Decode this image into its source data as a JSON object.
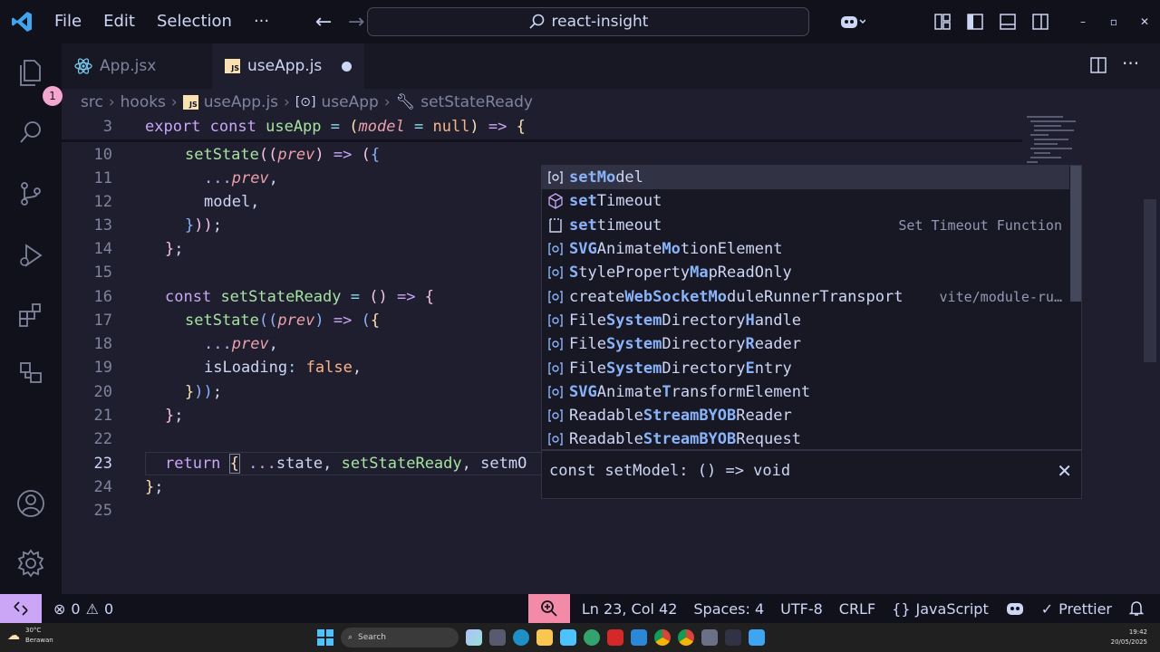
{
  "titlebar": {
    "menu": [
      "File",
      "Edit",
      "Selection",
      "···"
    ],
    "search_text": "react-insight",
    "window_controls": [
      "–",
      "▫",
      "✕"
    ]
  },
  "activity": {
    "explorer_badge": "1"
  },
  "tabs": [
    {
      "label": "App.jsx",
      "active": false
    },
    {
      "label": "useApp.js",
      "active": true,
      "dirty": true
    }
  ],
  "breadcrumb": [
    "src",
    "hooks",
    "useApp.js",
    "useApp",
    "setStateReady"
  ],
  "sticky_line": {
    "number": "3"
  },
  "line_numbers": [
    "10",
    "11",
    "12",
    "13",
    "14",
    "15",
    "16",
    "17",
    "18",
    "19",
    "20",
    "21",
    "22",
    "23",
    "24",
    "25"
  ],
  "code": {
    "export": "export",
    "const": "const",
    "useApp": "useApp",
    "eq": "=",
    "lp": "(",
    "model": "model",
    "null": "null",
    "rp": ")",
    "arrow": "=>",
    "lb": "{",
    "setState": "setState",
    "prev": "prev",
    "spread": "...",
    "model_prop": "model,",
    "close_obj": "}));",
    "close_fn": "};",
    "setStateReady": "setStateReady",
    "empty_parens": "()",
    "isLoading": "isLoading",
    "colon": ":",
    "false": "false",
    "comma": ",",
    "return": "return",
    "state": "state",
    "setmO": "setmO"
  },
  "suggestions": [
    {
      "pre": "",
      "match": "setMo",
      "post": "del",
      "icon": "variable-icon",
      "detail": "",
      "selected": true
    },
    {
      "pre": "",
      "match": "set",
      "post": "Timeout",
      "icon": "method-icon",
      "detail": "",
      "selected": false
    },
    {
      "pre": "",
      "match": "set",
      "post": "timeout",
      "icon": "snippet-icon",
      "detail": "Set Timeout Function",
      "selected": false
    },
    {
      "pre": "",
      "match": "SVG",
      "post": "Animate",
      "match2": "Mo",
      "post2": "tionElement",
      "icon": "variable-icon",
      "detail": "",
      "selected": false
    },
    {
      "pre": "",
      "match": "S",
      "post": "tyleProperty",
      "match2": "Ma",
      "post2": "pReadOnly",
      "icon": "variable-icon",
      "detail": "",
      "selected": false
    },
    {
      "pre": "create",
      "match": "WebSocketMo",
      "post": "duleRunnerTransport",
      "icon": "variable-icon",
      "detail": "vite/module-ru…",
      "selected": false
    },
    {
      "pre": "File",
      "match": "System",
      "post": "Directory",
      "match2": "H",
      "post2": "andle",
      "icon": "variable-icon",
      "detail": "",
      "selected": false
    },
    {
      "pre": "File",
      "match": "System",
      "post": "Directory",
      "match2": "R",
      "post2": "eader",
      "icon": "variable-icon",
      "detail": "",
      "selected": false
    },
    {
      "pre": "File",
      "match": "System",
      "post": "Directory",
      "match2": "E",
      "post2": "ntry",
      "icon": "variable-icon",
      "detail": "",
      "selected": false
    },
    {
      "pre": "",
      "match": "SVG",
      "post": "Animate",
      "match2": "T",
      "post2": "ransform",
      "match3": "",
      "post3": "Element",
      "icon": "variable-icon",
      "detail": "",
      "selected": false
    },
    {
      "pre": "Readable",
      "match": "Stream",
      "post": "BYOB",
      "match2": "",
      "post2": "Reader",
      "icon": "variable-icon",
      "detail": "",
      "selected": false
    },
    {
      "pre": "Readable",
      "match": "Stream",
      "post": "BYOB",
      "match2": "",
      "post2": "Request",
      "icon": "variable-icon",
      "detail": "",
      "selected": false
    }
  ],
  "details": {
    "signature": "const setModel: () => void"
  },
  "status": {
    "errors": "0",
    "warnings": "0",
    "position": "Ln 23, Col 42",
    "spaces": "Spaces: 4",
    "encoding": "UTF-8",
    "eol": "CRLF",
    "language": "JavaScript",
    "formatter": "Prettier"
  },
  "taskbar": {
    "temperature": "30°C",
    "weather": "Berawan",
    "search_label": "Search",
    "time": "19:42",
    "date": "20/05/2025"
  },
  "colors": {
    "background": "#1e1e2e",
    "accent": "#cba6f7",
    "zoom": "#f38ba8",
    "match": "#89b4fa"
  }
}
